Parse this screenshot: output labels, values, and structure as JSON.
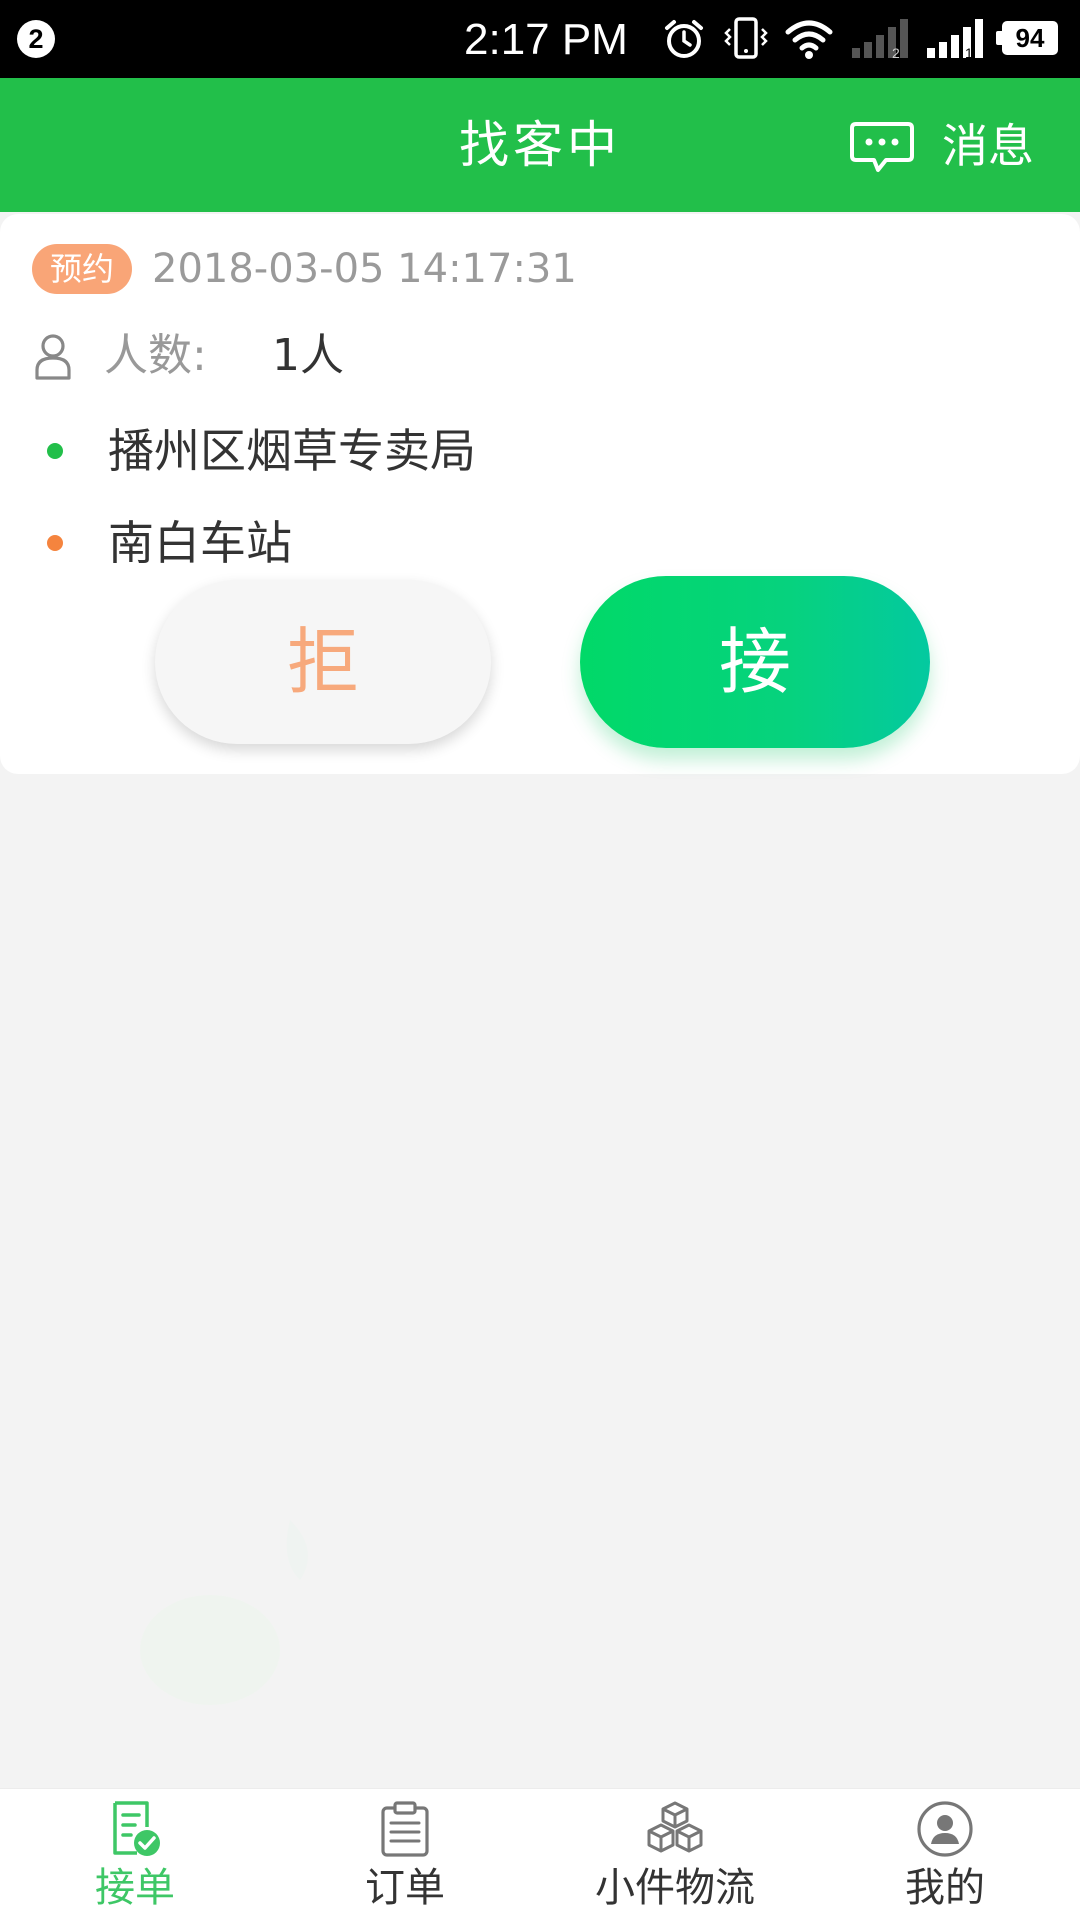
{
  "status_bar": {
    "notification_count": "2",
    "time": "2:17 PM",
    "battery": "94",
    "icons": [
      "alarm-icon",
      "vibrate-icon",
      "wifi-icon",
      "signal-sim2-icon",
      "signal-sim1-icon",
      "battery-icon"
    ]
  },
  "header": {
    "title": "找客中",
    "messages_label": "消息",
    "messages_icon": "chat-bubble-icon"
  },
  "order": {
    "badge": "预约",
    "datetime": "2018-03-05 14:17:31",
    "passenger_label": "人数:",
    "passenger_value": "1人",
    "pickup": "播州区烟草专卖局",
    "dropoff": "南白车站",
    "reject_label": "拒",
    "accept_label": "接"
  },
  "nav": {
    "items": [
      {
        "label": "接单",
        "icon": "accept-order-icon",
        "active": true
      },
      {
        "label": "订单",
        "icon": "clipboard-icon",
        "active": false
      },
      {
        "label": "小件物流",
        "icon": "boxes-icon",
        "active": false
      },
      {
        "label": "我的",
        "icon": "profile-icon",
        "active": false
      }
    ]
  },
  "colors": {
    "brand_green": "#22bf4a",
    "accept_gradient_start": "#01d968",
    "accept_gradient_end": "#04c9a0",
    "badge_orange": "#f9a577",
    "dropoff_orange": "#f5843e"
  }
}
